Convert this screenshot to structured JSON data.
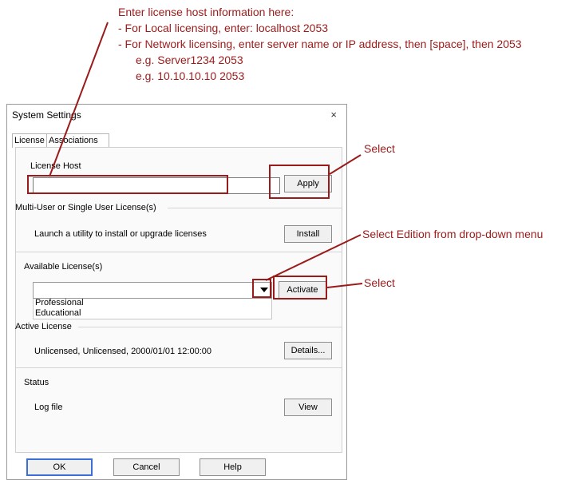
{
  "annotations": {
    "host_lines": [
      "Enter license host information here:",
      "- For Local licensing, enter: localhost 2053",
      "- For Network licensing, enter server name or IP address, then [space], then 2053",
      "e.g. Server1234 2053",
      "e.g. 10.10.10.10 2053"
    ],
    "select_apply": "Select",
    "select_edition": "Select Edition from drop-down menu",
    "select_activate": "Select"
  },
  "dialog": {
    "title": "System Settings",
    "close_glyph": "×",
    "tabs": [
      "License",
      "Associations"
    ],
    "license_host": {
      "label": "License Host",
      "value": "",
      "apply_label": "Apply"
    },
    "multi_user": {
      "heading": "Multi-User or Single User License(s)",
      "description": "Launch a utility to install or upgrade licenses",
      "install_label": "Install"
    },
    "available": {
      "heading": "Available License(s)",
      "selected": "",
      "options": [
        "Professional",
        "Educational"
      ],
      "activate_label": "Activate"
    },
    "active": {
      "heading": "Active License",
      "info": "Unlicensed,  Unlicensed,  2000/01/01 12:00:00",
      "details_label": "Details..."
    },
    "status": {
      "heading": "Status",
      "log_label": "Log file",
      "view_label": "View"
    },
    "footer": {
      "ok": "OK",
      "cancel": "Cancel",
      "help": "Help"
    }
  }
}
